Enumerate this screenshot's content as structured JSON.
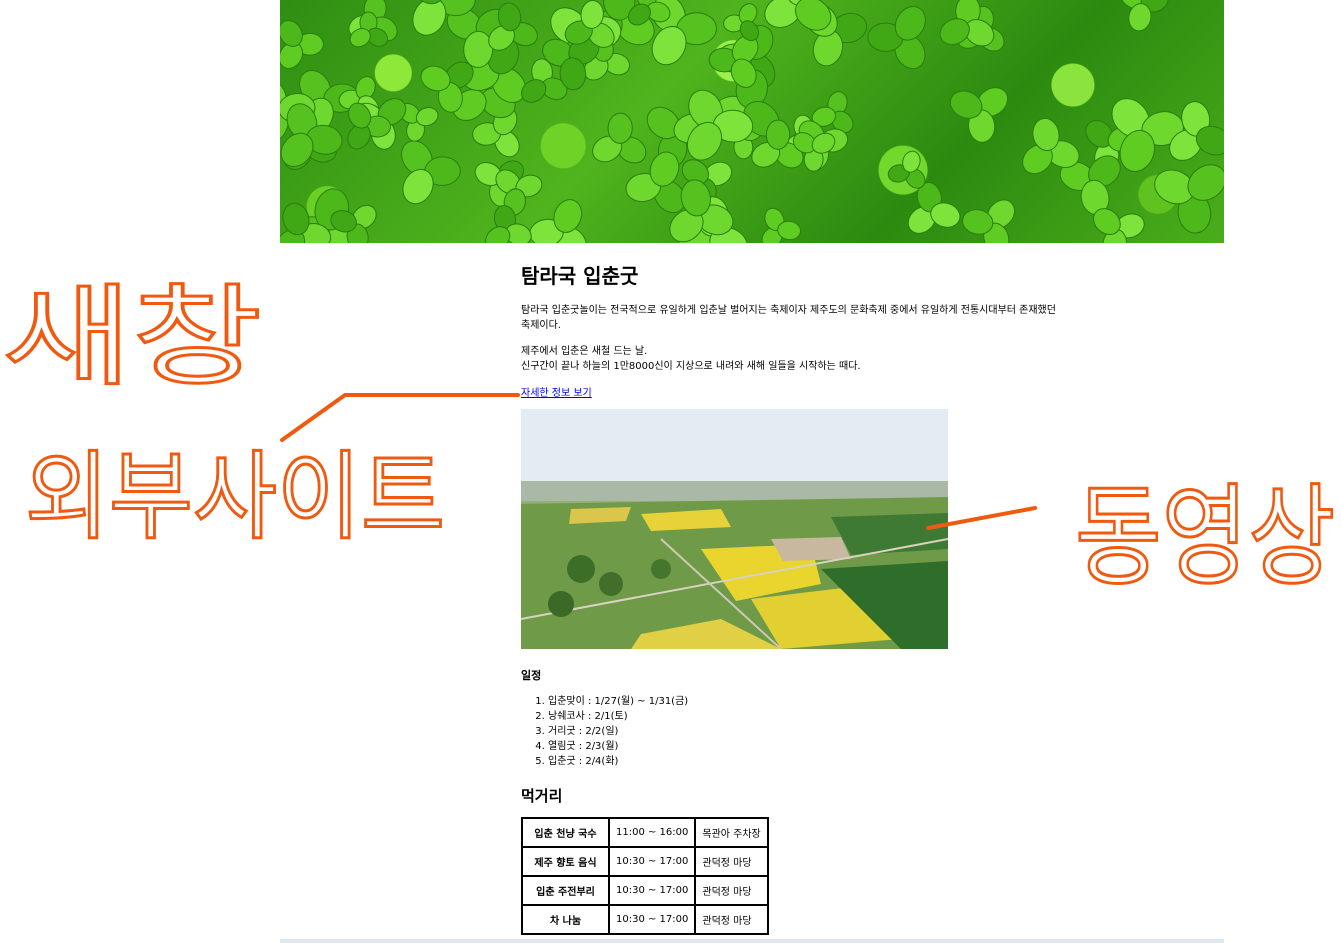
{
  "festival": {
    "title": "탐라국 입춘굿",
    "intro": "탐라국 입춘굿놀이는 전국적으로 유일하게 입춘날 벌어지는 축제이자 제주도의 문화축제 중에서 유일하게 전통시대부터 존재했던 축제이다.",
    "desc_line1": "제주에서 입춘은 새철 드는 날.",
    "desc_line2": "신구간이 끝나 하늘의 1만8000신이 지상으로 내려와 새해 일들을 시작하는 때다.",
    "link_text": "자세한 정보 보기"
  },
  "schedule": {
    "heading": "일정",
    "items": [
      "입춘맞이 : 1/27(월) ~ 1/31(금)",
      "낭쉐코사 : 2/1(토)",
      "거리굿 : 2/2(일)",
      "열림굿 : 2/3(월)",
      "입춘굿 : 2/4(화)"
    ]
  },
  "food": {
    "heading": "먹거리",
    "rows": [
      {
        "name": "입춘 천냥 국수",
        "time": "11:00 ~ 16:00",
        "place": "목관아 주차장"
      },
      {
        "name": "제주 향토 음식",
        "time": "10:30 ~ 17:00",
        "place": "관덕정 마당"
      },
      {
        "name": "입춘 주전부리",
        "time": "10:30 ~ 17:00",
        "place": "관덕정 마당"
      },
      {
        "name": "차 나눔",
        "time": "10:30 ~ 17:00",
        "place": "관덕정 마당"
      }
    ]
  },
  "annotations": {
    "left_word1": "새창",
    "left_word2": "외부사이트",
    "right_word": "동영상",
    "ink_color": "#f05a10"
  },
  "colors": {
    "link": "#0000ee",
    "banner_green": "#4fb41d"
  }
}
